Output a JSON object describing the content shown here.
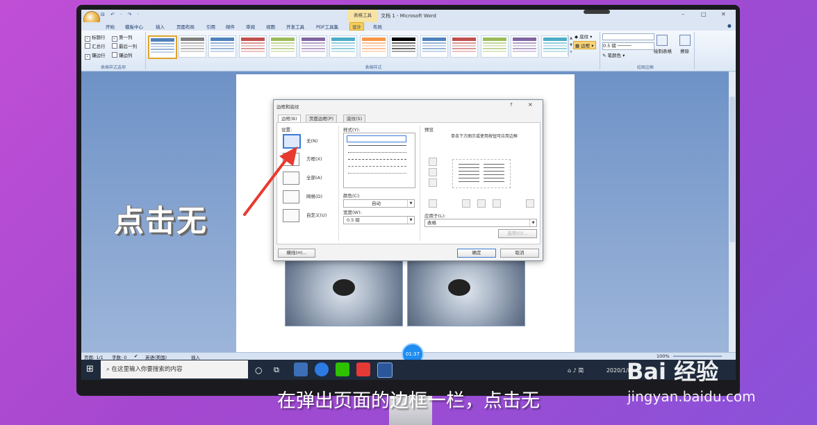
{
  "window": {
    "title": "文档 1 - Microsoft Word",
    "context_tab_group": "表格工具",
    "qat": "⊟ ↶ · ↷ ·"
  },
  "tabs": [
    "开始",
    "模板中心",
    "插入",
    "页面布局",
    "引用",
    "邮件",
    "审阅",
    "视图",
    "开发工具",
    "PDF工具集",
    "设计",
    "布局"
  ],
  "active_tab": "设计",
  "ribbon": {
    "style_options": {
      "checkboxes": [
        {
          "label": "标题行",
          "checked": true
        },
        {
          "label": "第一列",
          "checked": true
        },
        {
          "label": "汇总行",
          "checked": false
        },
        {
          "label": "最后一列",
          "checked": false
        },
        {
          "label": "镶边行",
          "checked": true
        },
        {
          "label": "镶边列",
          "checked": false
        }
      ],
      "group_label": "表格样式选项"
    },
    "table_styles_group_label": "表格样式",
    "shading_label": "底纹",
    "border_label": "边框",
    "pen_weight": "0.5 磅",
    "pen_color_label": "笔颜色",
    "draw_table_label": "绘制表格",
    "erase_label": "擦除",
    "draw_borders_group_label": "绘图边框",
    "accent_colors": [
      "#4f81bd",
      "#7f7f7f",
      "#4f81bd",
      "#c0504d",
      "#9bbb59",
      "#8064a2",
      "#4bacc6",
      "#f79646",
      "#000000",
      "#4f81bd",
      "#c0504d",
      "#9bbb59",
      "#8064a2",
      "#4bacc6"
    ]
  },
  "dialog": {
    "title": "边框和底纹",
    "help": "?",
    "close": "×",
    "tabs": [
      "边框(B)",
      "页面边框(P)",
      "底纹(S)"
    ],
    "setting_label": "设置:",
    "settings": [
      "无(N)",
      "方框(X)",
      "全部(A)",
      "网格(D)",
      "自定义(U)"
    ],
    "style_label": "样式(Y):",
    "color_label": "颜色(C):",
    "color_value": "自动",
    "width_label": "宽度(W):",
    "width_value": "0.5 磅",
    "preview_label": "预览",
    "preview_hint": "单击下方图示或使用按钮可应用边框",
    "apply_to_label": "应用于(L):",
    "apply_to_value": "表格",
    "options_button": "选项(O)...",
    "hline_button": "横线(H)...",
    "ok_button": "确定",
    "cancel_button": "取消"
  },
  "statusbar": {
    "page": "页面: 1/1",
    "words": "字数: 0",
    "language": "英语(美国)",
    "insert": "插入",
    "zoom": "100%"
  },
  "timer": "01:37",
  "taskbar": {
    "search_placeholder": "在这里输入你要搜索的内容",
    "tray_ime": "简",
    "tray_time": "2020/1/8"
  },
  "overlay": {
    "caption": "点击无",
    "subtitle": "在弹出页面的边框一栏，点击无",
    "watermark_brand": "Bai  经验",
    "watermark_url": "jingyan.baidu.com"
  }
}
